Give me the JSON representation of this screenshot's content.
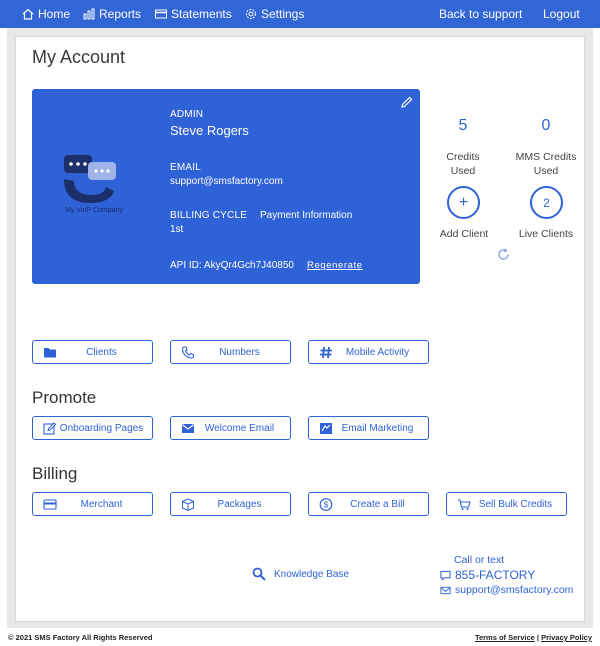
{
  "nav": {
    "home": "Home",
    "reports": "Reports",
    "statements": "Statements",
    "settings": "Settings",
    "back": "Back to support",
    "logout": "Logout"
  },
  "page_title": "My Account",
  "profile": {
    "logo_text": "My VoIP Company",
    "admin_label": "ADMIN",
    "admin_name": "Steve Rogers",
    "email_label": "EMAIL",
    "email_value": "support@smsfactory.com",
    "billing_label": "BILLING CYCLE",
    "billing_value": "1st",
    "payment_label": "Payment Information",
    "api_id": "API ID: AkyQr4Gch7J40850",
    "regenerate": "Regenerate"
  },
  "stats": {
    "credits_used_value": "5",
    "credits_used_label_1": "Credits",
    "credits_used_label_2": "Used",
    "mms_value": "0",
    "mms_label_1": "MMS Credits",
    "mms_label_2": "Used",
    "add_client_symbol": "+",
    "add_client_label": "Add Client",
    "live_clients_value": "2",
    "live_clients_label": "Live Clients"
  },
  "quick_actions": {
    "clients": "Clients",
    "numbers": "Numbers",
    "mobile_activity": "Mobile Activity"
  },
  "promote": {
    "title": "Promote",
    "onboarding": "Onboarding Pages",
    "welcome_email": "Welcome Email",
    "email_marketing": "Email Marketing"
  },
  "billing": {
    "title": "Billing",
    "merchant": "Merchant",
    "packages": "Packages",
    "create_bill": "Create a Bill",
    "sell_bulk": "Sell Bulk Credits"
  },
  "contact": {
    "knowledge_base": "Knowledge Base",
    "call_or_text": "Call or text",
    "phone": "855-FACTORY",
    "email": "support@smsfactory.com"
  },
  "footer": {
    "copyright": "© 2021 SMS Factory All Rights Reserved",
    "terms": "Terms of Service",
    "separator": "|",
    "privacy": "Privacy Policy"
  },
  "colors": {
    "accent": "#2f62d6",
    "nav_bg": "#3266d6"
  }
}
